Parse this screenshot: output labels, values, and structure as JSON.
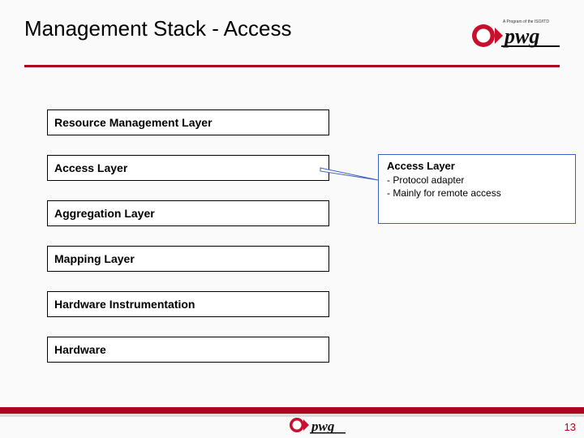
{
  "title": "Management Stack - Access",
  "layers": [
    "Resource Management Layer",
    "Access Layer",
    "Aggregation Layer",
    "Mapping Layer",
    "Hardware Instrumentation",
    "Hardware"
  ],
  "callout": {
    "title": "Access Layer",
    "lines": [
      "- Protocol adapter",
      "- Mainly for remote access"
    ]
  },
  "page_number": "13",
  "brand": "pwg",
  "brand_tag": "A Program of the ISO/ITD"
}
